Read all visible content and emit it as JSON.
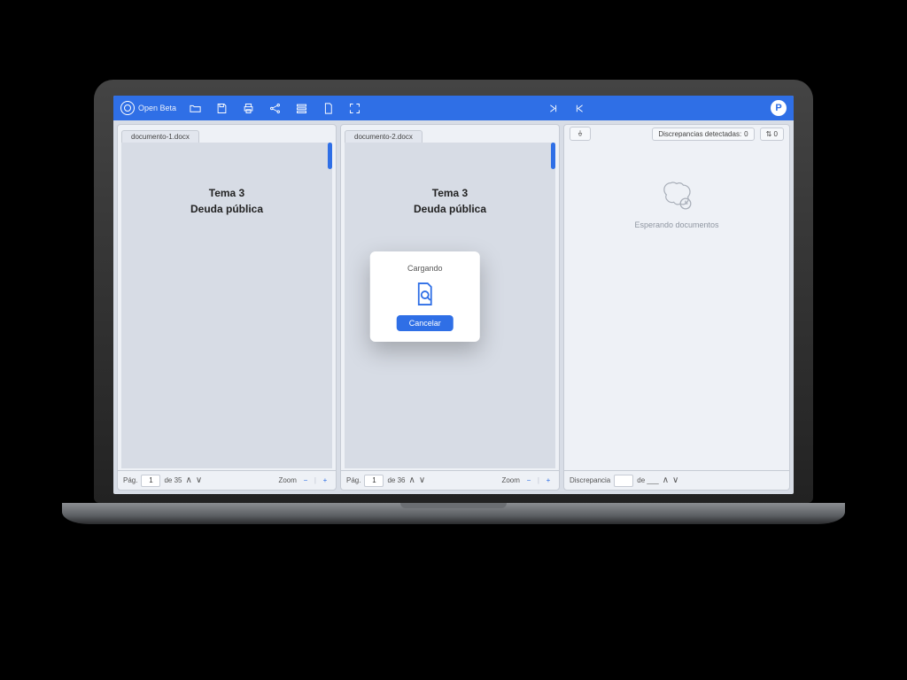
{
  "brand": {
    "label": "Open Beta"
  },
  "avatar": {
    "initial": "P"
  },
  "toolbar": {
    "nav_first_tooltip": ">|",
    "nav_last_tooltip": "|<"
  },
  "doc_panes": [
    {
      "tab": "documento-1.docx",
      "heading": "Tema 3",
      "subheading": "Deuda pública",
      "footer": {
        "page_label": "Pág.",
        "page_value": "1",
        "page_of": "de 35",
        "zoom_label": "Zoom"
      }
    },
    {
      "tab": "documento-2.docx",
      "heading": "Tema 3",
      "subheading": "Deuda pública",
      "footer": {
        "page_label": "Pág.",
        "page_value": "1",
        "page_of": "de 36",
        "zoom_label": "Zoom"
      }
    }
  ],
  "right_pane": {
    "pin_tooltip": "Fijar",
    "disc_label": "Discrepancias detectadas:",
    "disc_count": "0",
    "wrap_label": "⇅ 0",
    "waiting": "Esperando documentos",
    "footer": {
      "disc_label": "Discrepancia",
      "of_label": "de ___"
    }
  },
  "modal": {
    "title": "Cargando",
    "cancel": "Cancelar"
  }
}
